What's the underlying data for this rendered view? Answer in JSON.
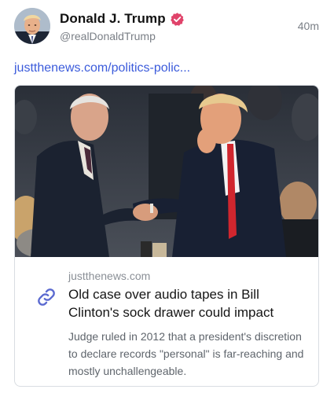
{
  "post": {
    "author": {
      "display_name": "Donald J. Trump",
      "handle": "@realDonaldTrump",
      "avatar_icon": "avatar-photo",
      "verified_icon": "verified-badge-icon",
      "verified_color": "#e0436a"
    },
    "timestamp": "40m",
    "link_text": "justthenews.com/politics-polic..."
  },
  "link_card": {
    "image_icon": "article-photo",
    "domain": "justthenews.com",
    "title": "Old case over audio tapes in Bill Clinton's sock drawer could impact",
    "description": "Judge ruled in 2012 that a president's discretion to declare records \"personal\" is far-reaching and mostly unchallengeable.",
    "link_icon": "link-chain-icon"
  },
  "colors": {
    "accent_link": "#3b5bdb",
    "link_icon": "#5b6ad0",
    "muted_text": "#7a7f86",
    "card_border": "#d9dde2"
  }
}
